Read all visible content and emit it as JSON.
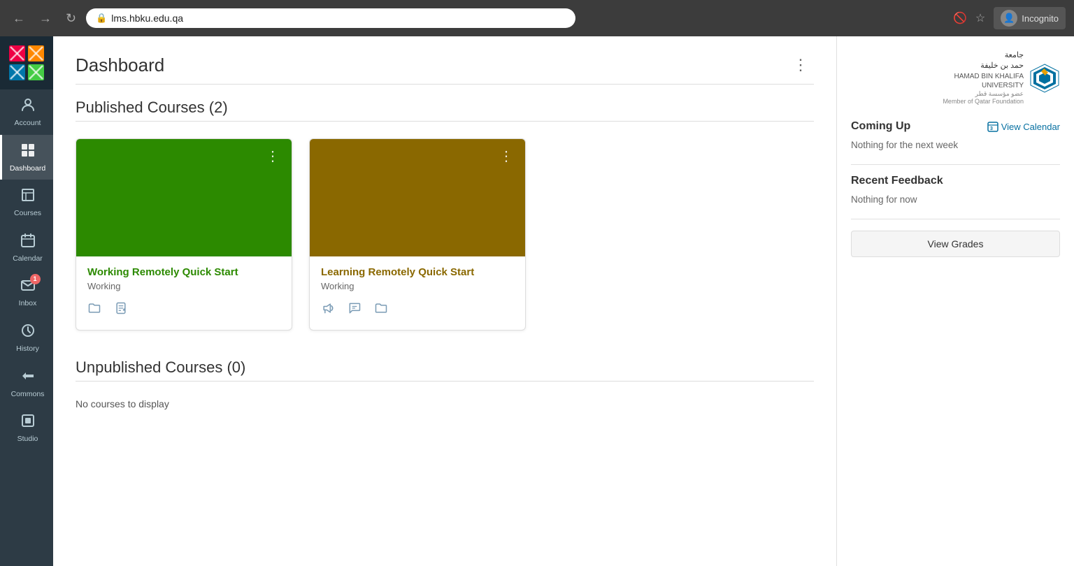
{
  "browser": {
    "url": "lms.hbku.edu.qa",
    "incognito_label": "Incognito"
  },
  "sidebar": {
    "logo_alt": "Canvas LMS Logo",
    "items": [
      {
        "id": "account",
        "label": "Account",
        "icon": "👤"
      },
      {
        "id": "dashboard",
        "label": "Dashboard",
        "icon": "⊞",
        "active": true
      },
      {
        "id": "courses",
        "label": "Courses",
        "icon": "📋"
      },
      {
        "id": "calendar",
        "label": "Calendar",
        "icon": "📅"
      },
      {
        "id": "inbox",
        "label": "Inbox",
        "icon": "💬",
        "badge": "1"
      },
      {
        "id": "history",
        "label": "History",
        "icon": "🕐"
      },
      {
        "id": "commons",
        "label": "Commons",
        "icon": "↩"
      },
      {
        "id": "studio",
        "label": "Studio",
        "icon": "⬛"
      }
    ]
  },
  "page": {
    "title": "Dashboard",
    "menu_btn": "⋮"
  },
  "published_courses": {
    "section_title": "Published Courses (2)",
    "cards": [
      {
        "id": "working-remotely",
        "name": "Working Remotely Quick Start",
        "status": "Working",
        "color_class": "green",
        "actions": [
          "folder",
          "edit"
        ],
        "menu_btn": "⋮"
      },
      {
        "id": "learning-remotely",
        "name": "Learning Remotely Quick Start",
        "status": "Working",
        "color_class": "brown",
        "actions": [
          "announcement",
          "chat",
          "folder"
        ],
        "menu_btn": "⋮"
      }
    ]
  },
  "unpublished_courses": {
    "section_title": "Unpublished Courses (0)",
    "empty_message": "No courses to display"
  },
  "right_sidebar": {
    "university": {
      "name_ar": "جامعة\nحمد بن خليفة",
      "name_en": "HAMAD BIN KHALIFA\nUNIVERSITY",
      "tagline": "عضو مؤسسة قطر\nMember of Qatar Foundation"
    },
    "coming_up": {
      "title": "Coming Up",
      "view_calendar_label": "View Calendar",
      "empty_message": "Nothing for the next week"
    },
    "recent_feedback": {
      "title": "Recent Feedback",
      "empty_message": "Nothing for now"
    },
    "view_grades_label": "View Grades"
  }
}
